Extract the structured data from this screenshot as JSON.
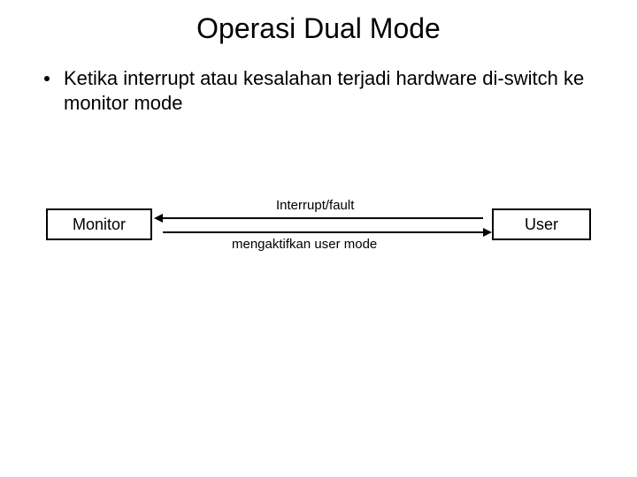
{
  "title": "Operasi Dual Mode",
  "bullet": {
    "text": "Ketika interrupt atau kesalahan terjadi hardware di-switch ke monitor mode"
  },
  "diagram": {
    "left_box": "Monitor",
    "right_box": "User",
    "arrow_top_label": "Interrupt/fault",
    "arrow_bottom_label": "mengaktifkan user mode"
  }
}
